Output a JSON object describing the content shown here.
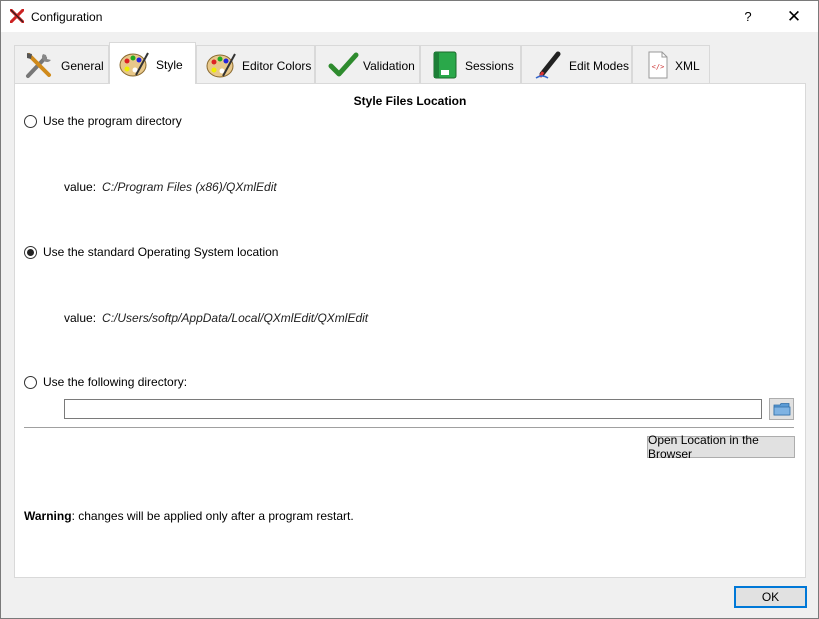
{
  "window": {
    "title": "Configuration",
    "help_label": "?",
    "close_label": "✕"
  },
  "tabs": [
    {
      "label": "General",
      "icon": "tools-icon",
      "active": false
    },
    {
      "label": "Style",
      "icon": "palette-icon",
      "active": true
    },
    {
      "label": "Editor Colors",
      "icon": "palette-icon",
      "active": false
    },
    {
      "label": "Validation",
      "icon": "checkmark-icon",
      "active": false
    },
    {
      "label": "Sessions",
      "icon": "green-book-icon",
      "active": false
    },
    {
      "label": "Edit Modes",
      "icon": "pen-icon",
      "active": false
    },
    {
      "label": "XML",
      "icon": "xml-document-icon",
      "active": false
    }
  ],
  "style": {
    "section_title": "Style Files Location",
    "option_program": {
      "label": "Use the program directory",
      "value_label": "value:",
      "value": "C:/Program Files (x86)/QXmlEdit",
      "checked": false
    },
    "option_standard": {
      "label": "Use the standard Operating System location",
      "value_label": "value:",
      "value": "C:/Users/softp/AppData/Local/QXmlEdit/QXmlEdit",
      "checked": true
    },
    "option_custom": {
      "label": "Use the following directory:",
      "value": "",
      "checked": false
    },
    "open_button": "Open Location in the Browser",
    "warning_bold": "Warning",
    "warning_text": ": changes will be applied only after a program restart."
  },
  "footer": {
    "ok_label": "OK"
  },
  "colors": {
    "accent": "#0078d7",
    "app_icon_red": "#cc2222"
  }
}
